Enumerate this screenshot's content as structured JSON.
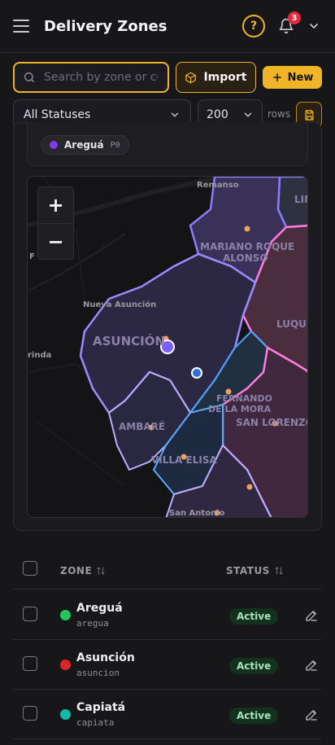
{
  "header": {
    "title": "Delivery Zones",
    "notification_count": "3"
  },
  "toolbar": {
    "search_placeholder": "Search by zone or code",
    "import_label": "Import",
    "new_label": "New",
    "status_filter": "All Statuses",
    "rows_value": "200",
    "rows_label": "rows"
  },
  "legend_chip": {
    "name": "Areguá",
    "priority": "P0",
    "color": "#7c3aed"
  },
  "map": {
    "labels": [
      "Remanso",
      "MARIANO ROQUE ALONSO",
      "Nueva Asunción",
      "ASUNCIÓN",
      "LUQUE",
      "Florida",
      "FERNANDO DE LA MORA",
      "SAN LORENZO",
      "LAMBARÉ",
      "VILLA ELISA",
      "San Antonio",
      "LIM",
      "F"
    ],
    "zoom_in": "+",
    "zoom_out": "−"
  },
  "table": {
    "columns": [
      "ZONE",
      "STATUS"
    ],
    "rows": [
      {
        "name": "Areguá",
        "slug": "aregua",
        "status": "Active",
        "color": "#22c55e"
      },
      {
        "name": "Asunción",
        "slug": "asuncion",
        "status": "Active",
        "color": "#dc2626"
      },
      {
        "name": "Capiatá",
        "slug": "capiata",
        "status": "Active",
        "color": "#14b8a6"
      }
    ]
  },
  "colors": {
    "accent": "#f0b428",
    "background": "#17171a",
    "status_active_bg": "#14301f",
    "status_active_text": "#a6e6b9"
  }
}
